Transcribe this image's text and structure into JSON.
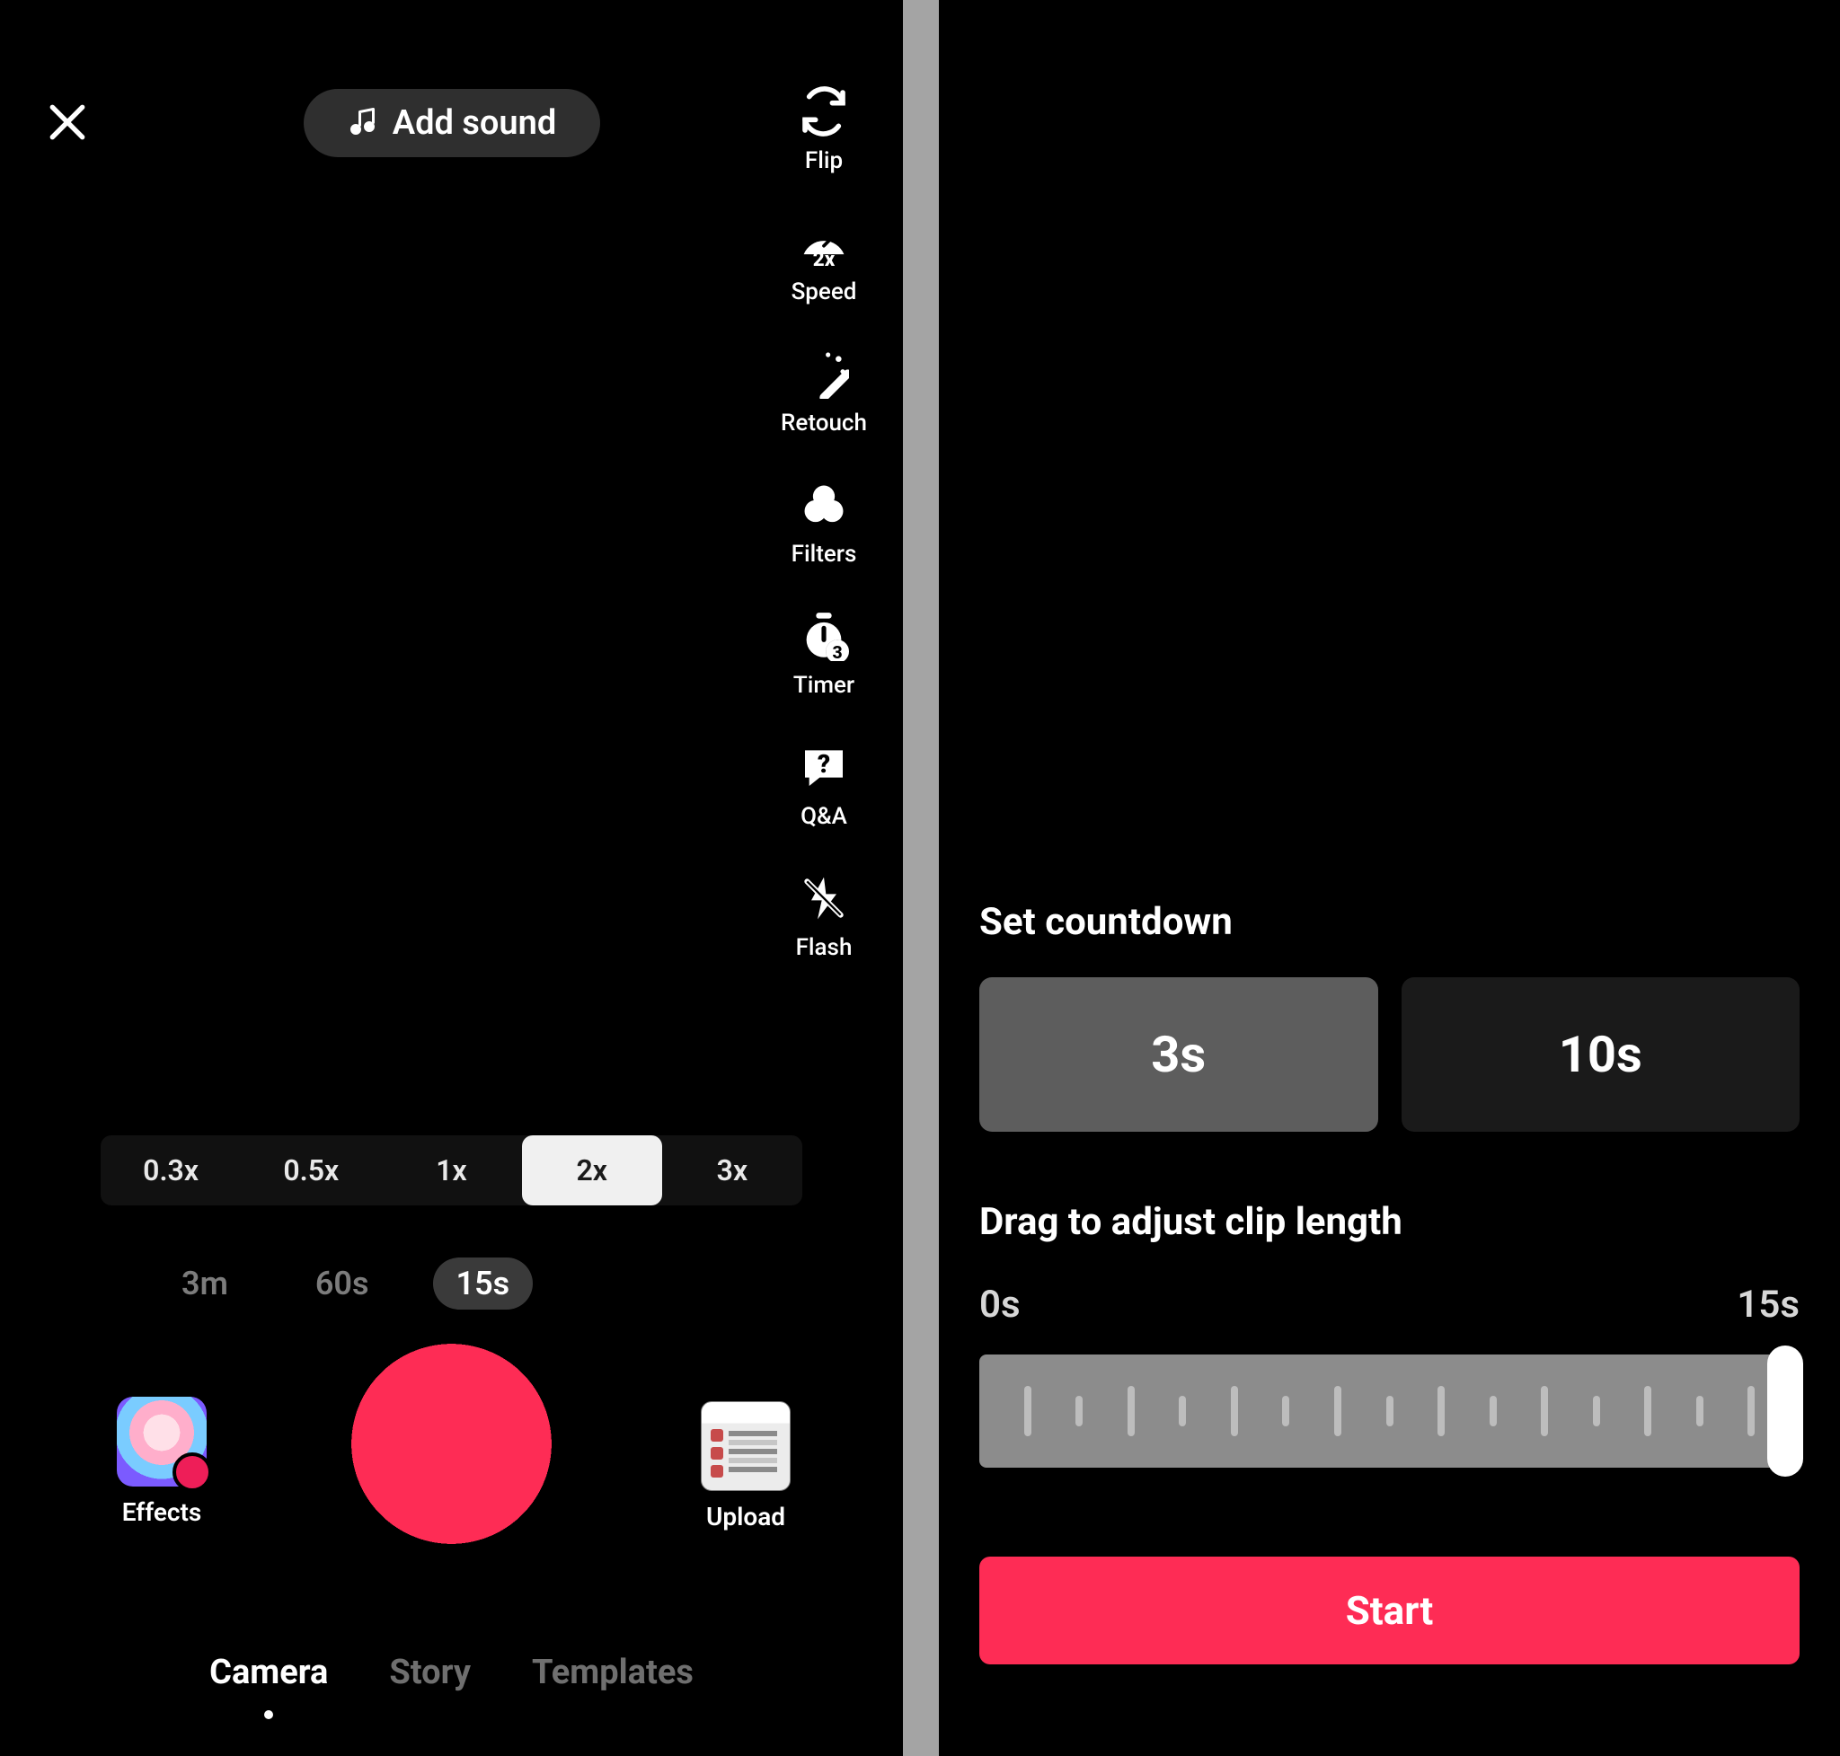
{
  "left": {
    "add_sound_label": "Add sound",
    "side_tools": {
      "flip": "Flip",
      "speed": "Speed",
      "retouch": "Retouch",
      "filters": "Filters",
      "timer": "Timer",
      "qa": "Q&A",
      "flash": "Flash"
    },
    "speed_options": {
      "o0": "0.3x",
      "o1": "0.5x",
      "o2": "1x",
      "o3": "2x",
      "o4": "3x",
      "selected": "2x"
    },
    "duration_options": {
      "d0": "3m",
      "d1": "60s",
      "d2": "15s",
      "selected": "15s"
    },
    "effects_label": "Effects",
    "upload_label": "Upload",
    "modes": {
      "m0": "Camera",
      "m1": "Story",
      "m2": "Templates",
      "selected": "Camera"
    }
  },
  "right": {
    "sheet_title": "Set countdown",
    "countdown_options": {
      "c0": "3s",
      "c1": "10s",
      "selected": "3s"
    },
    "drag_title": "Drag to adjust clip length",
    "range_min_label": "0s",
    "range_max_label": "15s",
    "start_label": "Start"
  },
  "colors": {
    "accent": "#fe2c55"
  }
}
